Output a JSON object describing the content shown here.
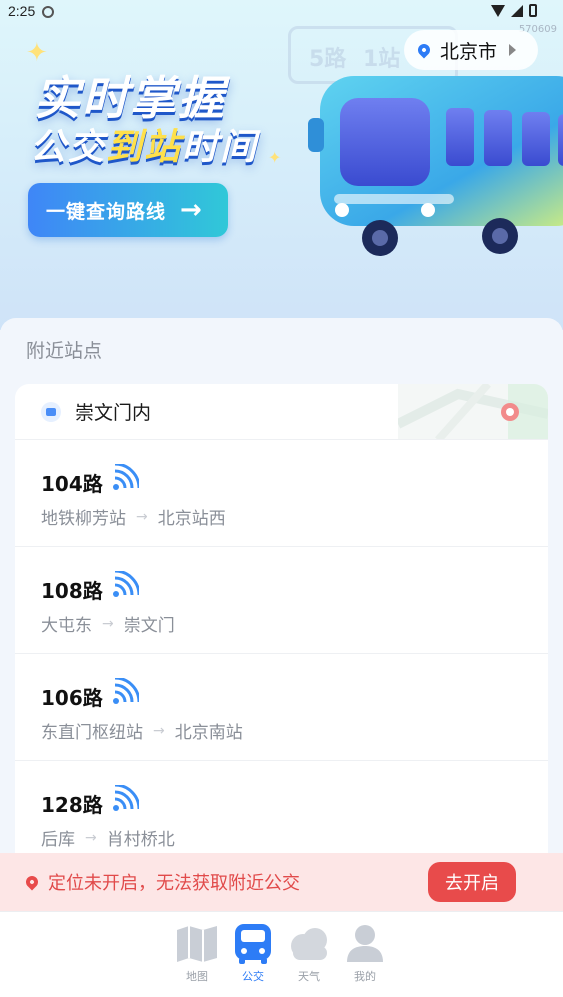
{
  "status_bar": {
    "time": "2:25",
    "build_id": "570609"
  },
  "banner": {
    "headline_line1": "实时掌握",
    "headline_line2_a": "公交",
    "headline_line2_highlight": "到站",
    "headline_line2_b": "时间",
    "cta_label": "一键查询路线",
    "cta_arrow": "→",
    "city": "北京市",
    "bg_sign_a": "5路",
    "bg_sign_b": "1站"
  },
  "nearby": {
    "section_title": "附近站点",
    "stop_name": "崇文门内",
    "routes": [
      {
        "name": "104路",
        "from": "地铁柳芳站",
        "to": "北京站西"
      },
      {
        "name": "108路",
        "from": "大屯东",
        "to": "崇文门"
      },
      {
        "name": "106路",
        "from": "东直门枢纽站",
        "to": "北京南站"
      },
      {
        "name": "128路",
        "from": "后库",
        "to": "肖村桥北"
      }
    ]
  },
  "alert": {
    "text": "定位未开启，无法获取附近公交",
    "button": "去开启"
  },
  "tabbar": {
    "items": [
      {
        "label": "地图",
        "icon": "map-icon",
        "active": false
      },
      {
        "label": "公交",
        "icon": "bus-icon",
        "active": true
      },
      {
        "label": "天气",
        "icon": "weather-cloud-icon",
        "active": false
      },
      {
        "label": "我的",
        "icon": "profile-icon",
        "active": false
      }
    ]
  },
  "colors": {
    "accent": "#2d7cf6",
    "alert": "#e84b4b",
    "highlight": "#ffe04a"
  }
}
